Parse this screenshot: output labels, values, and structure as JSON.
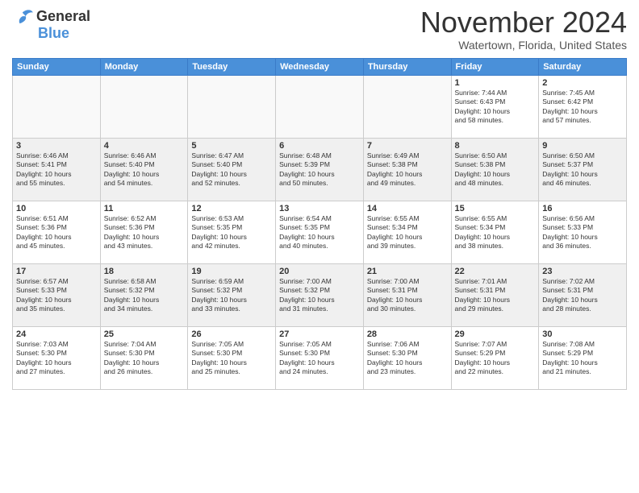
{
  "header": {
    "logo": {
      "general": "General",
      "blue": "Blue"
    },
    "title": "November 2024",
    "location": "Watertown, Florida, United States"
  },
  "calendar": {
    "headers": [
      "Sunday",
      "Monday",
      "Tuesday",
      "Wednesday",
      "Thursday",
      "Friday",
      "Saturday"
    ],
    "weeks": [
      [
        {
          "day": "",
          "info": "",
          "empty": true
        },
        {
          "day": "",
          "info": "",
          "empty": true
        },
        {
          "day": "",
          "info": "",
          "empty": true
        },
        {
          "day": "",
          "info": "",
          "empty": true
        },
        {
          "day": "",
          "info": "",
          "empty": true
        },
        {
          "day": "1",
          "info": "Sunrise: 7:44 AM\nSunset: 6:43 PM\nDaylight: 10 hours\nand 58 minutes."
        },
        {
          "day": "2",
          "info": "Sunrise: 7:45 AM\nSunset: 6:42 PM\nDaylight: 10 hours\nand 57 minutes."
        }
      ],
      [
        {
          "day": "3",
          "info": "Sunrise: 6:46 AM\nSunset: 5:41 PM\nDaylight: 10 hours\nand 55 minutes."
        },
        {
          "day": "4",
          "info": "Sunrise: 6:46 AM\nSunset: 5:40 PM\nDaylight: 10 hours\nand 54 minutes."
        },
        {
          "day": "5",
          "info": "Sunrise: 6:47 AM\nSunset: 5:40 PM\nDaylight: 10 hours\nand 52 minutes."
        },
        {
          "day": "6",
          "info": "Sunrise: 6:48 AM\nSunset: 5:39 PM\nDaylight: 10 hours\nand 50 minutes."
        },
        {
          "day": "7",
          "info": "Sunrise: 6:49 AM\nSunset: 5:38 PM\nDaylight: 10 hours\nand 49 minutes."
        },
        {
          "day": "8",
          "info": "Sunrise: 6:50 AM\nSunset: 5:38 PM\nDaylight: 10 hours\nand 48 minutes."
        },
        {
          "day": "9",
          "info": "Sunrise: 6:50 AM\nSunset: 5:37 PM\nDaylight: 10 hours\nand 46 minutes."
        }
      ],
      [
        {
          "day": "10",
          "info": "Sunrise: 6:51 AM\nSunset: 5:36 PM\nDaylight: 10 hours\nand 45 minutes."
        },
        {
          "day": "11",
          "info": "Sunrise: 6:52 AM\nSunset: 5:36 PM\nDaylight: 10 hours\nand 43 minutes."
        },
        {
          "day": "12",
          "info": "Sunrise: 6:53 AM\nSunset: 5:35 PM\nDaylight: 10 hours\nand 42 minutes."
        },
        {
          "day": "13",
          "info": "Sunrise: 6:54 AM\nSunset: 5:35 PM\nDaylight: 10 hours\nand 40 minutes."
        },
        {
          "day": "14",
          "info": "Sunrise: 6:55 AM\nSunset: 5:34 PM\nDaylight: 10 hours\nand 39 minutes."
        },
        {
          "day": "15",
          "info": "Sunrise: 6:55 AM\nSunset: 5:34 PM\nDaylight: 10 hours\nand 38 minutes."
        },
        {
          "day": "16",
          "info": "Sunrise: 6:56 AM\nSunset: 5:33 PM\nDaylight: 10 hours\nand 36 minutes."
        }
      ],
      [
        {
          "day": "17",
          "info": "Sunrise: 6:57 AM\nSunset: 5:33 PM\nDaylight: 10 hours\nand 35 minutes."
        },
        {
          "day": "18",
          "info": "Sunrise: 6:58 AM\nSunset: 5:32 PM\nDaylight: 10 hours\nand 34 minutes."
        },
        {
          "day": "19",
          "info": "Sunrise: 6:59 AM\nSunset: 5:32 PM\nDaylight: 10 hours\nand 33 minutes."
        },
        {
          "day": "20",
          "info": "Sunrise: 7:00 AM\nSunset: 5:32 PM\nDaylight: 10 hours\nand 31 minutes."
        },
        {
          "day": "21",
          "info": "Sunrise: 7:00 AM\nSunset: 5:31 PM\nDaylight: 10 hours\nand 30 minutes."
        },
        {
          "day": "22",
          "info": "Sunrise: 7:01 AM\nSunset: 5:31 PM\nDaylight: 10 hours\nand 29 minutes."
        },
        {
          "day": "23",
          "info": "Sunrise: 7:02 AM\nSunset: 5:31 PM\nDaylight: 10 hours\nand 28 minutes."
        }
      ],
      [
        {
          "day": "24",
          "info": "Sunrise: 7:03 AM\nSunset: 5:30 PM\nDaylight: 10 hours\nand 27 minutes."
        },
        {
          "day": "25",
          "info": "Sunrise: 7:04 AM\nSunset: 5:30 PM\nDaylight: 10 hours\nand 26 minutes."
        },
        {
          "day": "26",
          "info": "Sunrise: 7:05 AM\nSunset: 5:30 PM\nDaylight: 10 hours\nand 25 minutes."
        },
        {
          "day": "27",
          "info": "Sunrise: 7:05 AM\nSunset: 5:30 PM\nDaylight: 10 hours\nand 24 minutes."
        },
        {
          "day": "28",
          "info": "Sunrise: 7:06 AM\nSunset: 5:30 PM\nDaylight: 10 hours\nand 23 minutes."
        },
        {
          "day": "29",
          "info": "Sunrise: 7:07 AM\nSunset: 5:29 PM\nDaylight: 10 hours\nand 22 minutes."
        },
        {
          "day": "30",
          "info": "Sunrise: 7:08 AM\nSunset: 5:29 PM\nDaylight: 10 hours\nand 21 minutes."
        }
      ]
    ]
  }
}
